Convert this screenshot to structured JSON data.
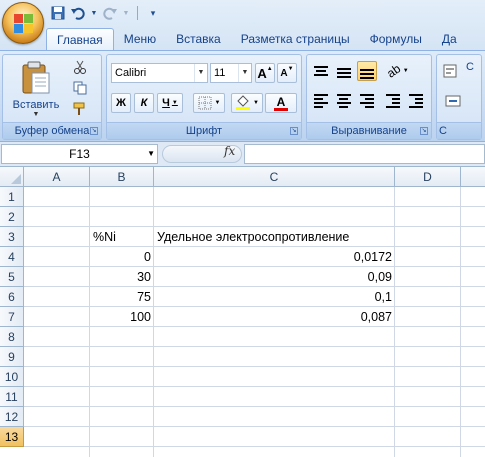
{
  "quick_access": {
    "save_icon": "save-icon",
    "undo_icon": "undo-icon",
    "redo_icon": "redo-icon",
    "customize_icon": "customize-qat-icon"
  },
  "tabs": [
    {
      "label": "Главная",
      "active": true
    },
    {
      "label": "Меню",
      "active": false
    },
    {
      "label": "Вставка",
      "active": false
    },
    {
      "label": "Разметка страницы",
      "active": false
    },
    {
      "label": "Формулы",
      "active": false
    },
    {
      "label": "Да",
      "active": false
    }
  ],
  "ribbon": {
    "clipboard": {
      "paste_label": "Вставить",
      "group_label": "Буфер обмена"
    },
    "font": {
      "name": "Calibri",
      "size": "11",
      "bold": "Ж",
      "italic": "К",
      "underline": "Ч",
      "grow": "A",
      "shrink": "A",
      "font_color_letter": "A",
      "group_label": "Шрифт",
      "highlight_color": "#ffff00",
      "font_color": "#e00000"
    },
    "alignment": {
      "group_label": "Выравнивание"
    },
    "number": {
      "group_label": "С"
    }
  },
  "formula_bar": {
    "name_box": "F13",
    "fx": "fx",
    "value": ""
  },
  "columns": [
    "A",
    "B",
    "C",
    "D"
  ],
  "rows": [
    "1",
    "2",
    "3",
    "4",
    "5",
    "6",
    "7",
    "8",
    "9",
    "10",
    "11",
    "12",
    "13"
  ],
  "selected_row": "13",
  "cells": {
    "B3": "%Ni",
    "C3": "Удельное электросопротивление",
    "B4": "0",
    "C4": "0,0172",
    "B5": "30",
    "C5": "0,09",
    "B6": "75",
    "C6": "0,1",
    "B7": "100",
    "C7": "0,087"
  },
  "colors": {
    "accent": "#15428b",
    "ribbon": "#c6daf3",
    "selection": "#f1c15f"
  }
}
